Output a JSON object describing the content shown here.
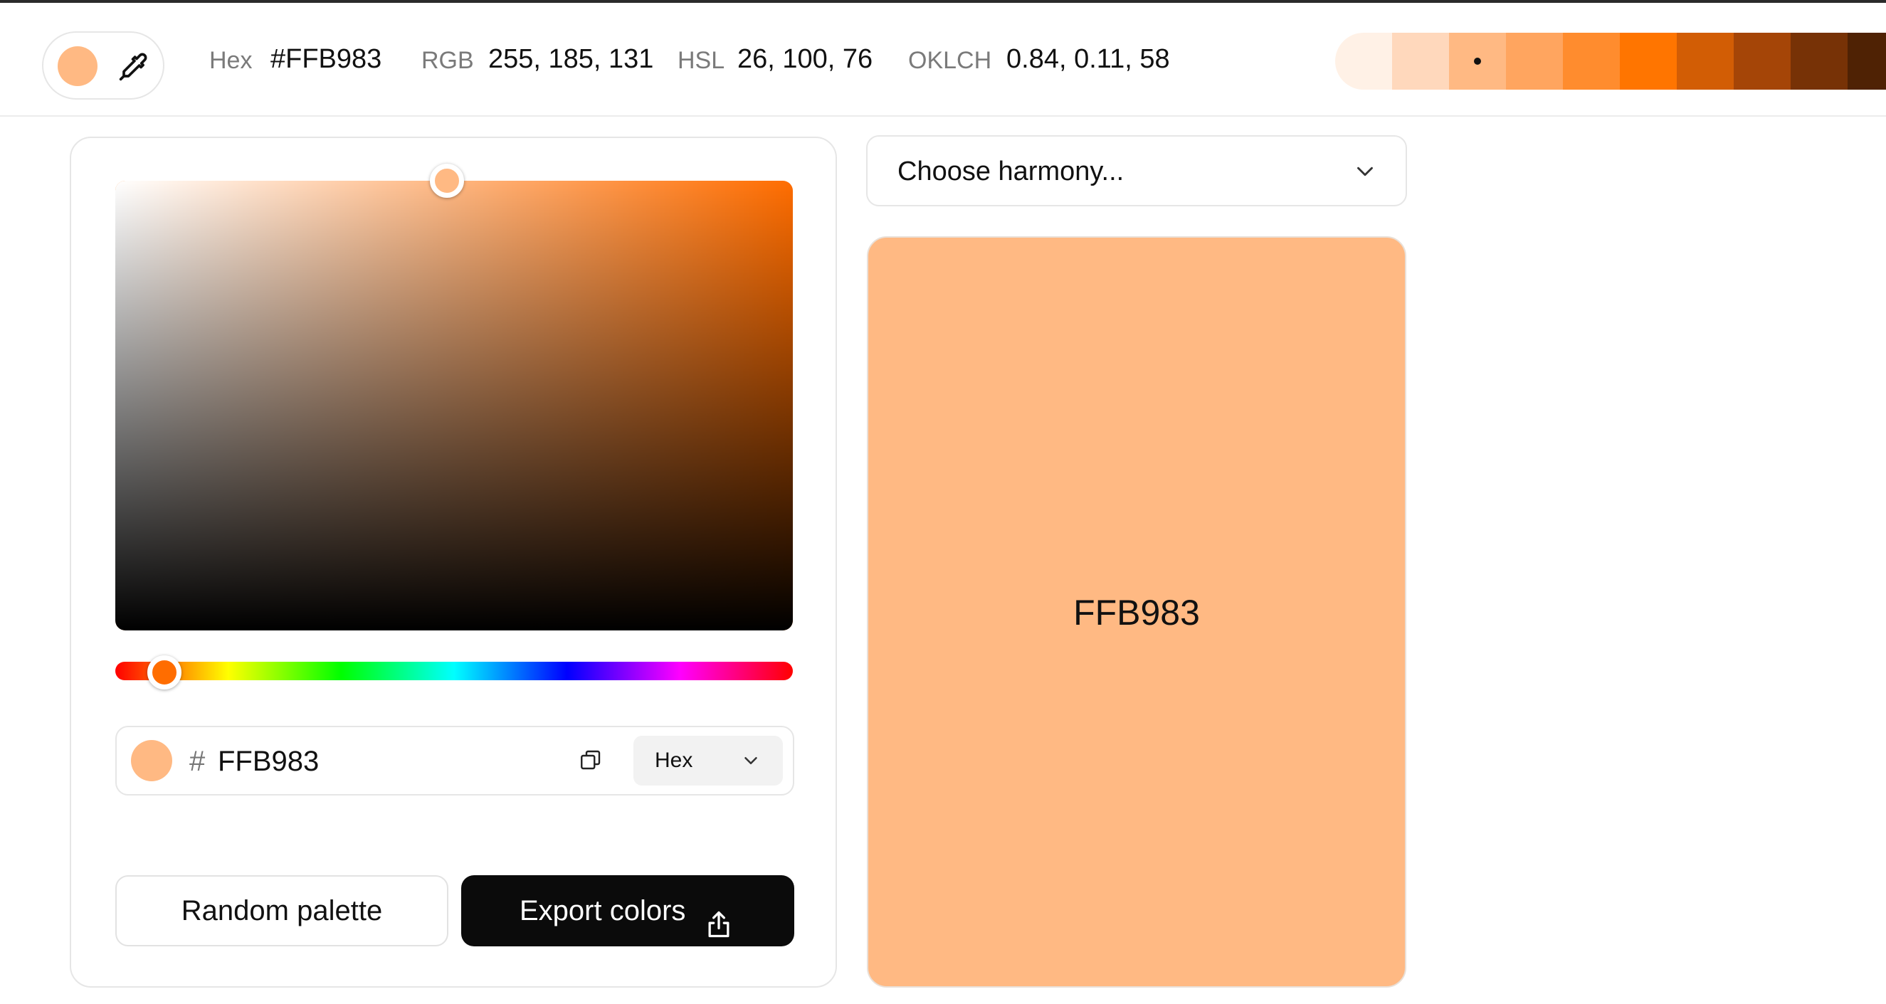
{
  "colors": {
    "current": "#FFB983",
    "hue_base": "#FF6D00"
  },
  "topbar": {
    "eyedropper_icon": "eyedropper-icon",
    "values": [
      {
        "label": "Hex",
        "value": "#FFB983"
      },
      {
        "label": "RGB",
        "value": "255, 185, 131"
      },
      {
        "label": "HSL",
        "value": "26, 100, 76"
      },
      {
        "label": "OKLCH",
        "value": "0.84, 0.11, 58"
      }
    ],
    "shades": [
      "#FFF1E6",
      "#FFD8BC",
      "#FFB983",
      "#FFA55F",
      "#FF8C2E",
      "#FF7500",
      "#D25D05",
      "#A54507",
      "#773206",
      "#4F2204"
    ],
    "selected_shade_index": 2
  },
  "picker": {
    "saturation": 0.49,
    "value": 1.0,
    "hue_degrees": 26,
    "hex_prefix": "#",
    "hex_value": "FFB983",
    "copy_icon": "copy-icon",
    "format_selected": "Hex"
  },
  "actions": {
    "random_label": "Random palette",
    "export_label": "Export colors",
    "export_icon": "share-icon"
  },
  "harmony": {
    "placeholder": "Choose harmony..."
  },
  "preview": {
    "code": "FFB983"
  }
}
